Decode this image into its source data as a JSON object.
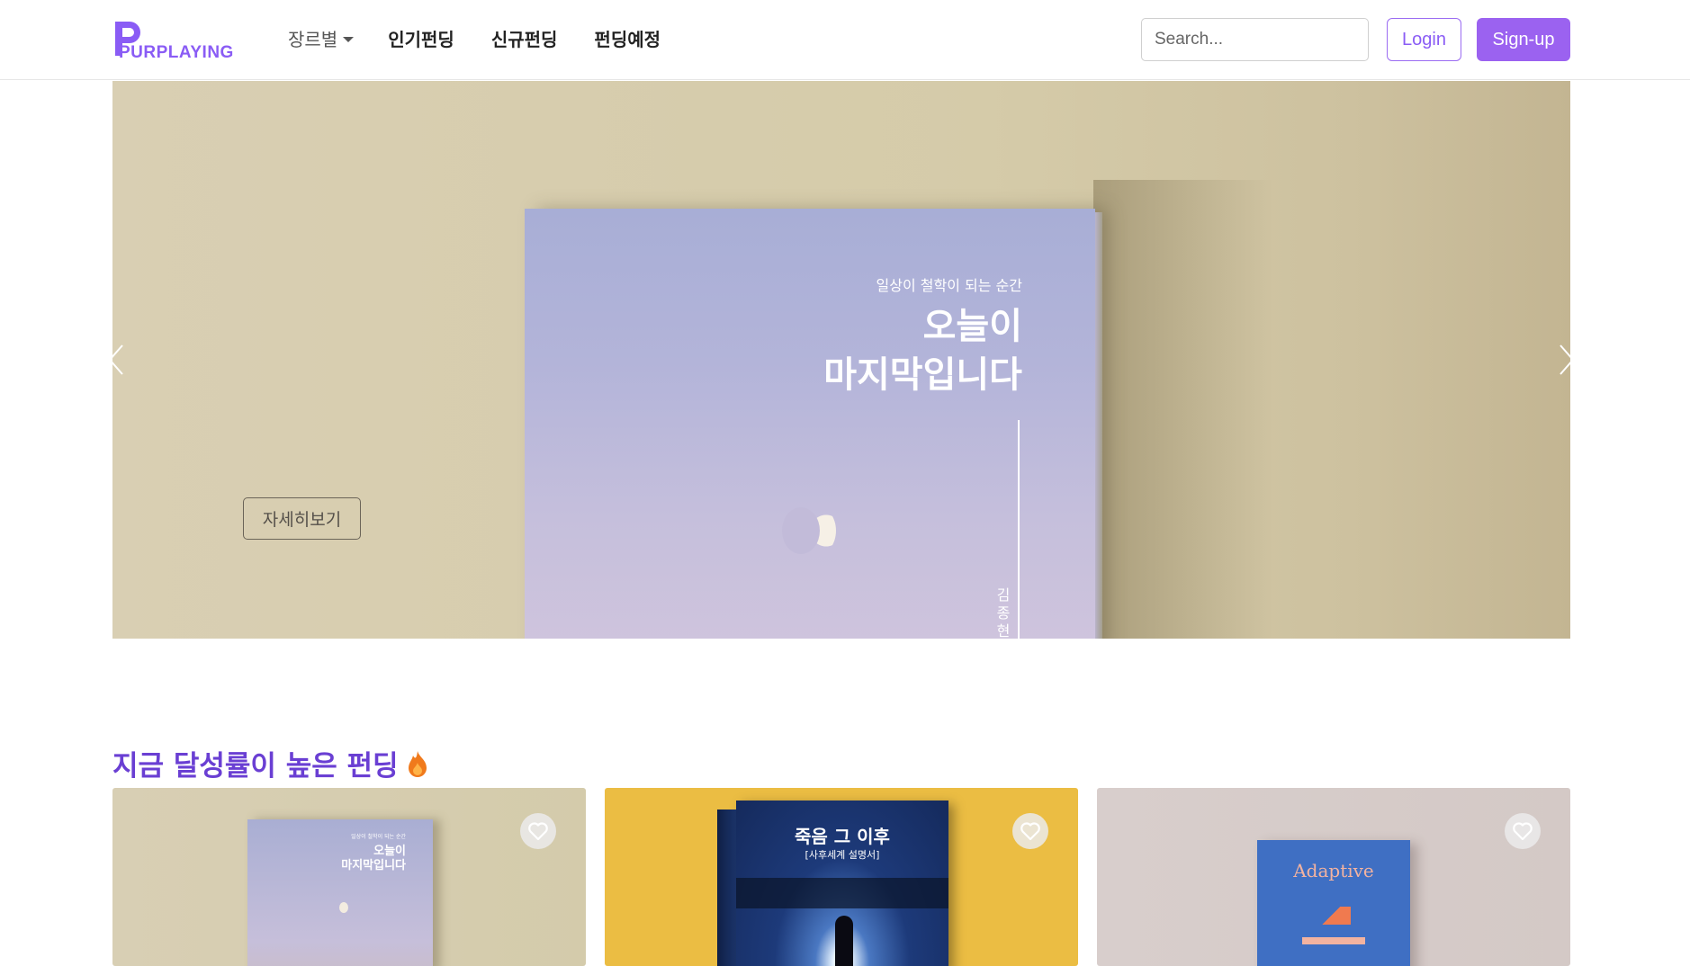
{
  "brand": {
    "name": "PURPLAYING"
  },
  "nav": {
    "genre": "장르별",
    "popular": "인기펀딩",
    "new": "신규펀딩",
    "upcoming": "펀딩예정"
  },
  "search": {
    "placeholder": "Search..."
  },
  "auth": {
    "login": "Login",
    "signup": "Sign-up"
  },
  "hero": {
    "book_subtitle": "일상이 철학이 되는 순간",
    "book_title": "오늘이\n마지막입니다",
    "book_author": "김종현",
    "detail_button": "자세히보기"
  },
  "section": {
    "title": "지금 달성률이 높은 펀딩",
    "cards": [
      {
        "cover_title": "오늘이\n마지막입니다",
        "cover_subtitle": "일상이 철학이 되는 순간",
        "bg": "#d6cdae"
      },
      {
        "cover_title": "죽음 그 이후",
        "cover_subtitle": "[사후세계 설명서]",
        "bg": "#ebbd43"
      },
      {
        "cover_title": "Adaptive",
        "bg": "#d6cbc8"
      }
    ]
  },
  "colors": {
    "accent": "#9b62f0",
    "title": "#6a3fd3"
  }
}
